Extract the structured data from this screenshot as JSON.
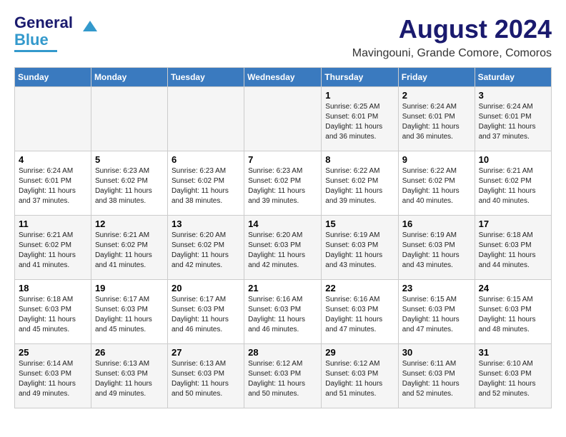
{
  "logo": {
    "line1": "General",
    "line2": "Blue"
  },
  "title": {
    "month_year": "August 2024",
    "location": "Mavingouni, Grande Comore, Comoros"
  },
  "days_of_week": [
    "Sunday",
    "Monday",
    "Tuesday",
    "Wednesday",
    "Thursday",
    "Friday",
    "Saturday"
  ],
  "weeks": [
    [
      {
        "day": "",
        "info": ""
      },
      {
        "day": "",
        "info": ""
      },
      {
        "day": "",
        "info": ""
      },
      {
        "day": "",
        "info": ""
      },
      {
        "day": "1",
        "info": "Sunrise: 6:25 AM\nSunset: 6:01 PM\nDaylight: 11 hours and 36 minutes."
      },
      {
        "day": "2",
        "info": "Sunrise: 6:24 AM\nSunset: 6:01 PM\nDaylight: 11 hours and 36 minutes."
      },
      {
        "day": "3",
        "info": "Sunrise: 6:24 AM\nSunset: 6:01 PM\nDaylight: 11 hours and 37 minutes."
      }
    ],
    [
      {
        "day": "4",
        "info": "Sunrise: 6:24 AM\nSunset: 6:01 PM\nDaylight: 11 hours and 37 minutes."
      },
      {
        "day": "5",
        "info": "Sunrise: 6:23 AM\nSunset: 6:02 PM\nDaylight: 11 hours and 38 minutes."
      },
      {
        "day": "6",
        "info": "Sunrise: 6:23 AM\nSunset: 6:02 PM\nDaylight: 11 hours and 38 minutes."
      },
      {
        "day": "7",
        "info": "Sunrise: 6:23 AM\nSunset: 6:02 PM\nDaylight: 11 hours and 39 minutes."
      },
      {
        "day": "8",
        "info": "Sunrise: 6:22 AM\nSunset: 6:02 PM\nDaylight: 11 hours and 39 minutes."
      },
      {
        "day": "9",
        "info": "Sunrise: 6:22 AM\nSunset: 6:02 PM\nDaylight: 11 hours and 40 minutes."
      },
      {
        "day": "10",
        "info": "Sunrise: 6:21 AM\nSunset: 6:02 PM\nDaylight: 11 hours and 40 minutes."
      }
    ],
    [
      {
        "day": "11",
        "info": "Sunrise: 6:21 AM\nSunset: 6:02 PM\nDaylight: 11 hours and 41 minutes."
      },
      {
        "day": "12",
        "info": "Sunrise: 6:21 AM\nSunset: 6:02 PM\nDaylight: 11 hours and 41 minutes."
      },
      {
        "day": "13",
        "info": "Sunrise: 6:20 AM\nSunset: 6:02 PM\nDaylight: 11 hours and 42 minutes."
      },
      {
        "day": "14",
        "info": "Sunrise: 6:20 AM\nSunset: 6:03 PM\nDaylight: 11 hours and 42 minutes."
      },
      {
        "day": "15",
        "info": "Sunrise: 6:19 AM\nSunset: 6:03 PM\nDaylight: 11 hours and 43 minutes."
      },
      {
        "day": "16",
        "info": "Sunrise: 6:19 AM\nSunset: 6:03 PM\nDaylight: 11 hours and 43 minutes."
      },
      {
        "day": "17",
        "info": "Sunrise: 6:18 AM\nSunset: 6:03 PM\nDaylight: 11 hours and 44 minutes."
      }
    ],
    [
      {
        "day": "18",
        "info": "Sunrise: 6:18 AM\nSunset: 6:03 PM\nDaylight: 11 hours and 45 minutes."
      },
      {
        "day": "19",
        "info": "Sunrise: 6:17 AM\nSunset: 6:03 PM\nDaylight: 11 hours and 45 minutes."
      },
      {
        "day": "20",
        "info": "Sunrise: 6:17 AM\nSunset: 6:03 PM\nDaylight: 11 hours and 46 minutes."
      },
      {
        "day": "21",
        "info": "Sunrise: 6:16 AM\nSunset: 6:03 PM\nDaylight: 11 hours and 46 minutes."
      },
      {
        "day": "22",
        "info": "Sunrise: 6:16 AM\nSunset: 6:03 PM\nDaylight: 11 hours and 47 minutes."
      },
      {
        "day": "23",
        "info": "Sunrise: 6:15 AM\nSunset: 6:03 PM\nDaylight: 11 hours and 47 minutes."
      },
      {
        "day": "24",
        "info": "Sunrise: 6:15 AM\nSunset: 6:03 PM\nDaylight: 11 hours and 48 minutes."
      }
    ],
    [
      {
        "day": "25",
        "info": "Sunrise: 6:14 AM\nSunset: 6:03 PM\nDaylight: 11 hours and 49 minutes."
      },
      {
        "day": "26",
        "info": "Sunrise: 6:13 AM\nSunset: 6:03 PM\nDaylight: 11 hours and 49 minutes."
      },
      {
        "day": "27",
        "info": "Sunrise: 6:13 AM\nSunset: 6:03 PM\nDaylight: 11 hours and 50 minutes."
      },
      {
        "day": "28",
        "info": "Sunrise: 6:12 AM\nSunset: 6:03 PM\nDaylight: 11 hours and 50 minutes."
      },
      {
        "day": "29",
        "info": "Sunrise: 6:12 AM\nSunset: 6:03 PM\nDaylight: 11 hours and 51 minutes."
      },
      {
        "day": "30",
        "info": "Sunrise: 6:11 AM\nSunset: 6:03 PM\nDaylight: 11 hours and 52 minutes."
      },
      {
        "day": "31",
        "info": "Sunrise: 6:10 AM\nSunset: 6:03 PM\nDaylight: 11 hours and 52 minutes."
      }
    ]
  ]
}
